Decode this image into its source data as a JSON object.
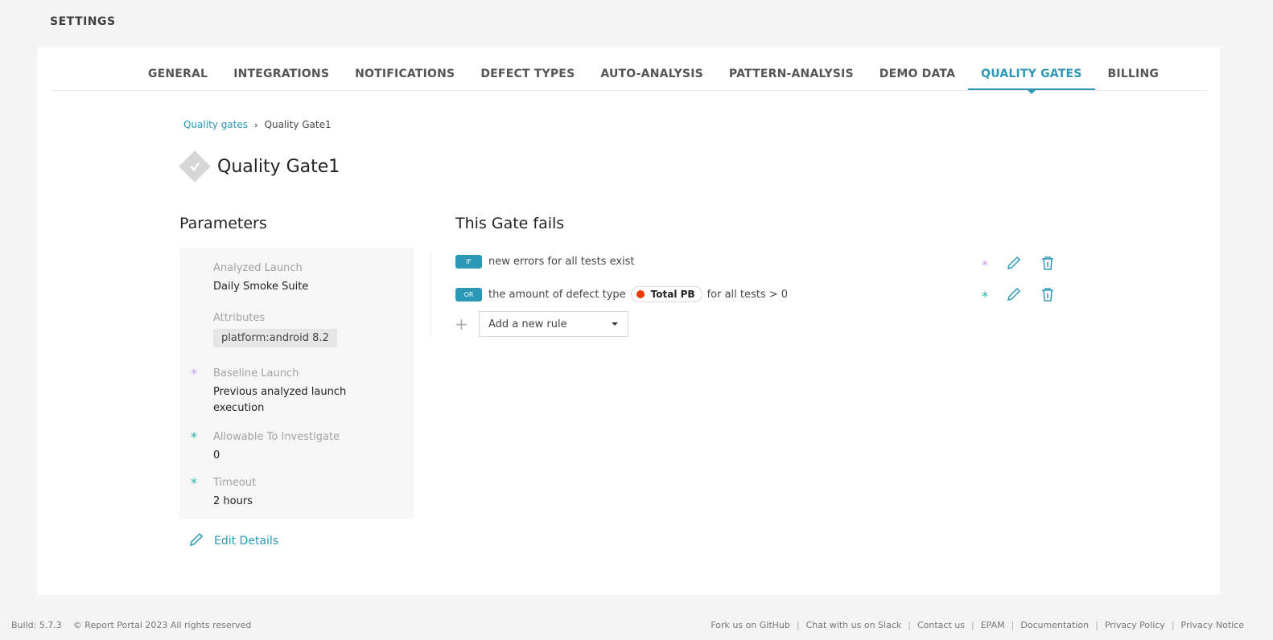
{
  "page": {
    "title": "SETTINGS"
  },
  "tabs": [
    {
      "label": "GENERAL"
    },
    {
      "label": "INTEGRATIONS"
    },
    {
      "label": "NOTIFICATIONS"
    },
    {
      "label": "DEFECT TYPES"
    },
    {
      "label": "AUTO-ANALYSIS"
    },
    {
      "label": "PATTERN-ANALYSIS"
    },
    {
      "label": "DEMO DATA"
    },
    {
      "label": "QUALITY GATES"
    },
    {
      "label": "BILLING"
    }
  ],
  "active_tab": "QUALITY GATES",
  "breadcrumb": {
    "parent": "Quality gates",
    "current": "Quality Gate1"
  },
  "gate": {
    "name": "Quality Gate1",
    "icon": "diamond-check-icon"
  },
  "parameters": {
    "title": "Parameters",
    "analyzed_launch": {
      "label": "Analyzed Launch",
      "value": "Daily Smoke Suite"
    },
    "attributes": {
      "label": "Attributes",
      "chip": "platform:android 8.2"
    },
    "baseline_launch": {
      "label": "Baseline Launch",
      "value": "Previous analyzed launch execution",
      "star_color": "#c4a0e8"
    },
    "allowable": {
      "label": "Allowable To Investigate",
      "value": "0",
      "star_color": "#22b3a3"
    },
    "timeout": {
      "label": "Timeout",
      "value": "2 hours",
      "star_color": "#22b3a3"
    },
    "edit_label": "Edit Details"
  },
  "rules": {
    "title": "This Gate fails",
    "items": [
      {
        "badge": "IF",
        "text": "new errors for all tests exist",
        "star_color": "#c4a0e8"
      },
      {
        "badge": "OR",
        "prefix": "the amount of defect type",
        "defect": "Total PB",
        "defect_color": "#ec3900",
        "suffix": "for all tests > 0",
        "star_color": "#22b3a3"
      }
    ],
    "add_rule_placeholder": "Add a new rule"
  },
  "footer": {
    "build": "Build: 5.7.3",
    "copyright": "© Report Portal 2023 All rights reserved",
    "links": [
      "Fork us on GitHub",
      "Chat with us on Slack",
      "Contact us",
      "EPAM",
      "Documentation",
      "Privacy Policy",
      "Privacy Notice"
    ]
  },
  "colors": {
    "accent": "#2b98b6"
  }
}
